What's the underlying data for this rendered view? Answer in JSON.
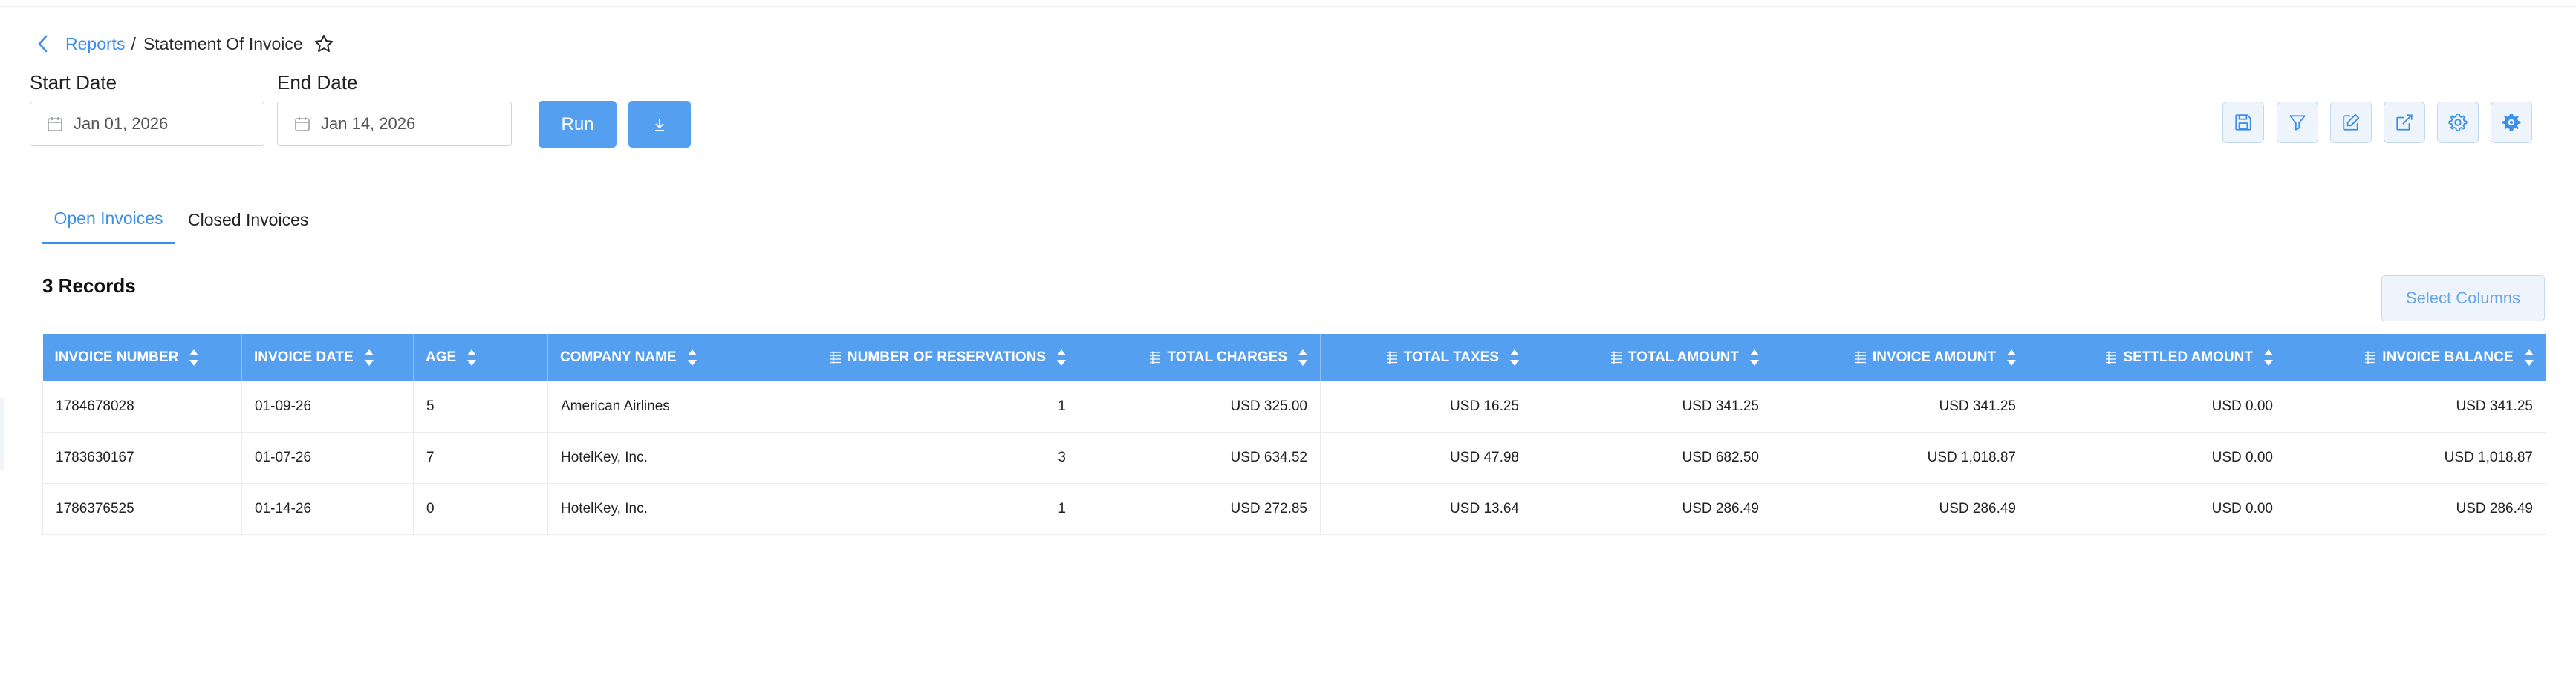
{
  "breadcrumb": {
    "parent": "Reports",
    "separator": "/",
    "current": "Statement Of Invoice"
  },
  "filters": {
    "start_date": {
      "label": "Start Date",
      "value": "Jan 01, 2026"
    },
    "end_date": {
      "label": "End Date",
      "value": "Jan 14, 2026"
    }
  },
  "actions": {
    "run_label": "Run"
  },
  "toolbar": {
    "icons": [
      "save-icon",
      "filter-icon",
      "edit-icon",
      "external-link-icon",
      "settings-icon",
      "settings-gear-icon"
    ]
  },
  "tabs": [
    {
      "label": "Open Invoices",
      "active": true
    },
    {
      "label": "Closed Invoices",
      "active": false
    }
  ],
  "records_label": "3 Records",
  "select_columns_label": "Select Columns",
  "colors": {
    "accent": "#559ff0",
    "link": "#3d8fe8"
  },
  "table": {
    "columns": [
      "INVOICE NUMBER",
      "INVOICE DATE",
      "AGE",
      "COMPANY NAME",
      "NUMBER OF RESERVATIONS",
      "TOTAL CHARGES",
      "TOTAL TAXES",
      "TOTAL AMOUNT",
      "INVOICE AMOUNT",
      "SETTLED AMOUNT",
      "INVOICE BALANCE"
    ],
    "rows": [
      [
        "1784678028",
        "01-09-26",
        "5",
        "American Airlines",
        "1",
        "USD 325.00",
        "USD 16.25",
        "USD 341.25",
        "USD 341.25",
        "USD 0.00",
        "USD 341.25"
      ],
      [
        "1783630167",
        "01-07-26",
        "7",
        "HotelKey, Inc.",
        "3",
        "USD 634.52",
        "USD 47.98",
        "USD 682.50",
        "USD 1,018.87",
        "USD 0.00",
        "USD 1,018.87"
      ],
      [
        "1786376525",
        "01-14-26",
        "0",
        "HotelKey, Inc.",
        "1",
        "USD 272.85",
        "USD 13.64",
        "USD 286.49",
        "USD 286.49",
        "USD 0.00",
        "USD 286.49"
      ]
    ]
  }
}
